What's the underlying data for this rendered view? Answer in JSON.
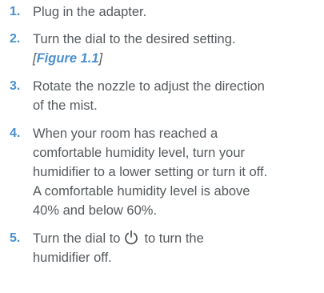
{
  "steps": [
    {
      "number": "1.",
      "lines": [
        "Plug in the adapter."
      ]
    },
    {
      "number": "2.",
      "lines": [
        "Turn the dial to the desired setting."
      ],
      "figure_ref": {
        "open": "[",
        "label": "Figure 1.1",
        "close": "]"
      }
    },
    {
      "number": "3.",
      "lines": [
        "Rotate the nozzle to adjust the direction",
        "of the mist."
      ]
    },
    {
      "number": "4.",
      "lines": [
        "When your room has reached a",
        "comfortable humidity level, turn your",
        "humidifier to a lower setting or turn it off.",
        "A comfortable humidity level is above",
        "40% and below 60%."
      ]
    },
    {
      "number": "5.",
      "lines": [
        "to turn the",
        "humidifier off."
      ],
      "lead": "Turn the dial to",
      "icon": "power-icon"
    }
  ]
}
